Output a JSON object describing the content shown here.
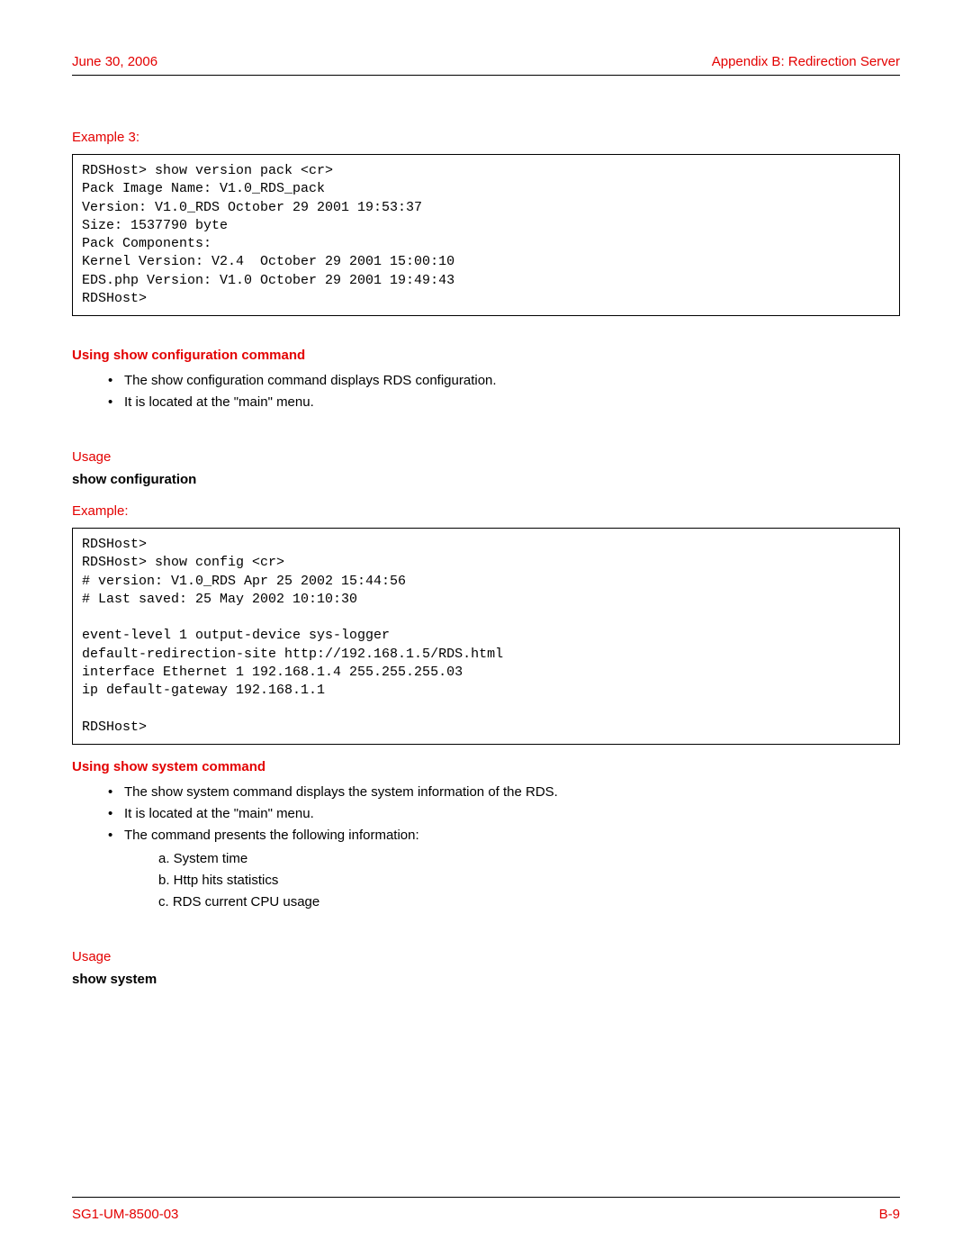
{
  "header": {
    "date": "June 30, 2006",
    "appendix": "Appendix B: Redirection Server"
  },
  "example3": {
    "label": "Example 3:",
    "code": "RDSHost> show version pack <cr>\nPack Image Name: V1.0_RDS_pack\nVersion: V1.0_RDS October 29 2001 19:53:37\nSize: 1537790 byte\nPack Components:\nKernel Version: V2.4  October 29 2001 15:00:10\nEDS.php Version: V1.0 October 29 2001 19:49:43\nRDSHost>"
  },
  "section_config": {
    "heading": "Using show configuration command",
    "bullet1": "The show configuration command displays RDS configuration.",
    "bullet2": "It is located at the \"main\" menu."
  },
  "usage_config": {
    "label": "Usage",
    "cmd": "show configuration"
  },
  "example_config": {
    "label": "Example:",
    "code": "RDSHost>\nRDSHost> show config <cr>\n# version: V1.0_RDS Apr 25 2002 15:44:56\n# Last saved: 25 May 2002 10:10:30\n\nevent-level 1 output-device sys-logger\ndefault-redirection-site http://192.168.1.5/RDS.html\ninterface Ethernet 1 192.168.1.4 255.255.255.03\nip default-gateway 192.168.1.1\n\nRDSHost>"
  },
  "section_system": {
    "heading": "Using show system command",
    "bullet1": "The show system command displays the system information of the RDS.",
    "bullet2": "It is located at the \"main\" menu.",
    "bullet3": "The command presents the following information:",
    "sub_a": "a. System time",
    "sub_b": "b. Http hits statistics",
    "sub_c": "c. RDS current CPU usage"
  },
  "usage_system": {
    "label": "Usage",
    "cmd": "show system"
  },
  "footer": {
    "docid": "SG1-UM-8500-03",
    "page": "B-9"
  }
}
